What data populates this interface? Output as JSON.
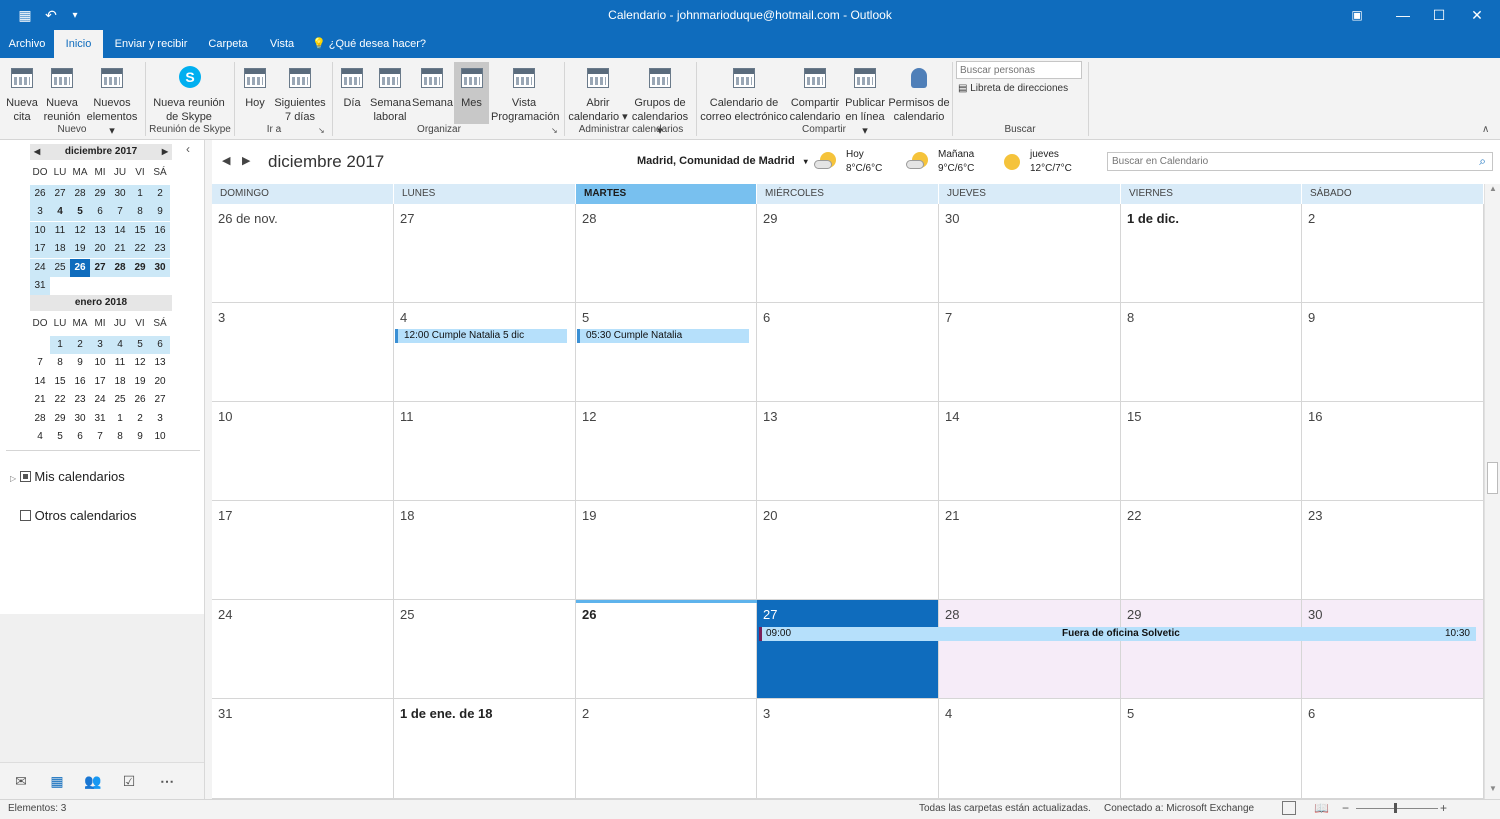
{
  "window": {
    "title": "Calendario - johnmarioduque@hotmail.com - Outlook"
  },
  "tabs": [
    {
      "label": "Archivo"
    },
    {
      "label": "Inicio"
    },
    {
      "label": "Enviar y recibir"
    },
    {
      "label": "Carpeta"
    },
    {
      "label": "Vista"
    },
    {
      "label": "¿Qué desea hacer?"
    }
  ],
  "ribbon": {
    "buttons": [
      {
        "line1": "Nueva",
        "line2": "cita"
      },
      {
        "line1": "Nueva",
        "line2": "reunión"
      },
      {
        "line1": "Nuevos",
        "line2": "elementos ▾"
      },
      {
        "line1": "Nueva reunión",
        "line2": "de Skype"
      },
      {
        "line1": "Hoy",
        "line2": ""
      },
      {
        "line1": "Siguientes",
        "line2": "7 días"
      },
      {
        "line1": "Día",
        "line2": ""
      },
      {
        "line1": "Semana",
        "line2": "laboral"
      },
      {
        "line1": "Semana",
        "line2": ""
      },
      {
        "line1": "Mes",
        "line2": ""
      },
      {
        "line1": "Vista",
        "line2": "Programación"
      },
      {
        "line1": "Abrir",
        "line2": "calendario ▾"
      },
      {
        "line1": "Grupos de",
        "line2": "calendarios ▾"
      },
      {
        "line1": "Calendario de",
        "line2": "correo electrónico"
      },
      {
        "line1": "Compartir",
        "line2": "calendario"
      },
      {
        "line1": "Publicar",
        "line2": "en línea ▾"
      },
      {
        "line1": "Permisos de",
        "line2": "calendario"
      }
    ],
    "groups": [
      "Nuevo",
      "Reunión de Skype",
      "Ir a",
      "Organizar",
      "Administrar calendarios",
      "Compartir",
      "Buscar"
    ],
    "search_people_placeholder": "Buscar personas",
    "address_book": "Libreta de direcciones"
  },
  "minical": {
    "dow": [
      "DO",
      "LU",
      "MA",
      "MI",
      "JU",
      "VI",
      "SÁ"
    ],
    "months": [
      {
        "title": "diciembre 2017",
        "weeks": [
          [
            "26",
            "27",
            "28",
            "29",
            "30",
            "1",
            "2"
          ],
          [
            "3",
            "4",
            "5",
            "6",
            "7",
            "8",
            "9"
          ],
          [
            "10",
            "11",
            "12",
            "13",
            "14",
            "15",
            "16"
          ],
          [
            "17",
            "18",
            "19",
            "20",
            "21",
            "22",
            "23"
          ],
          [
            "24",
            "25",
            "26",
            "27",
            "28",
            "29",
            "30"
          ],
          [
            "31",
            "",
            "",
            "",
            "",
            "",
            ""
          ]
        ]
      },
      {
        "title": "enero 2018",
        "weeks": [
          [
            "",
            "1",
            "2",
            "3",
            "4",
            "5",
            "6"
          ],
          [
            "7",
            "8",
            "9",
            "10",
            "11",
            "12",
            "13"
          ],
          [
            "14",
            "15",
            "16",
            "17",
            "18",
            "19",
            "20"
          ],
          [
            "21",
            "22",
            "23",
            "24",
            "25",
            "26",
            "27"
          ],
          [
            "28",
            "29",
            "30",
            "31",
            "1",
            "2",
            "3"
          ],
          [
            "4",
            "5",
            "6",
            "7",
            "8",
            "9",
            "10"
          ]
        ]
      }
    ]
  },
  "folders": [
    {
      "label": "Mis calendarios"
    },
    {
      "label": "Otros calendarios"
    }
  ],
  "calendar": {
    "title": "diciembre 2017",
    "location": "Madrid, Comunidad de Madrid",
    "weather": [
      {
        "day": "Hoy",
        "temp": "8°C/6°C"
      },
      {
        "day": "Mañana",
        "temp": "9°C/6°C"
      },
      {
        "day": "jueves",
        "temp": "12°C/7°C"
      }
    ],
    "search_placeholder": "Buscar en Calendario",
    "weekdays": [
      "DOMINGO",
      "LUNES",
      "MARTES",
      "MIÉRCOLES",
      "JUEVES",
      "VIERNES",
      "SÁBADO"
    ],
    "weeks": [
      [
        "26 de nov.",
        "27",
        "28",
        "29",
        "30",
        "1 de dic.",
        "2"
      ],
      [
        "3",
        "4",
        "5",
        "6",
        "7",
        "8",
        "9"
      ],
      [
        "10",
        "11",
        "12",
        "13",
        "14",
        "15",
        "16"
      ],
      [
        "17",
        "18",
        "19",
        "20",
        "21",
        "22",
        "23"
      ],
      [
        "24",
        "25",
        "26",
        "27",
        "28",
        "29",
        "30"
      ],
      [
        "31",
        "1 de ene. de 18",
        "2",
        "3",
        "4",
        "5",
        "6"
      ]
    ],
    "events": [
      {
        "text": "12:00 Cumple Natalia 5 dic"
      },
      {
        "text": "05:30 Cumple Natalia"
      },
      {
        "start": "09:00",
        "title": "Fuera de oficina Solvetic",
        "end": "10:30"
      }
    ]
  },
  "status": {
    "items": "Elementos: 3",
    "sync": "Todas las carpetas están actualizadas.",
    "connection": "Conectado a: Microsoft Exchange"
  },
  "colors": {
    "accent": "#0f6cbd",
    "today": "#0f6cbd",
    "event": "#b6e0fb"
  }
}
